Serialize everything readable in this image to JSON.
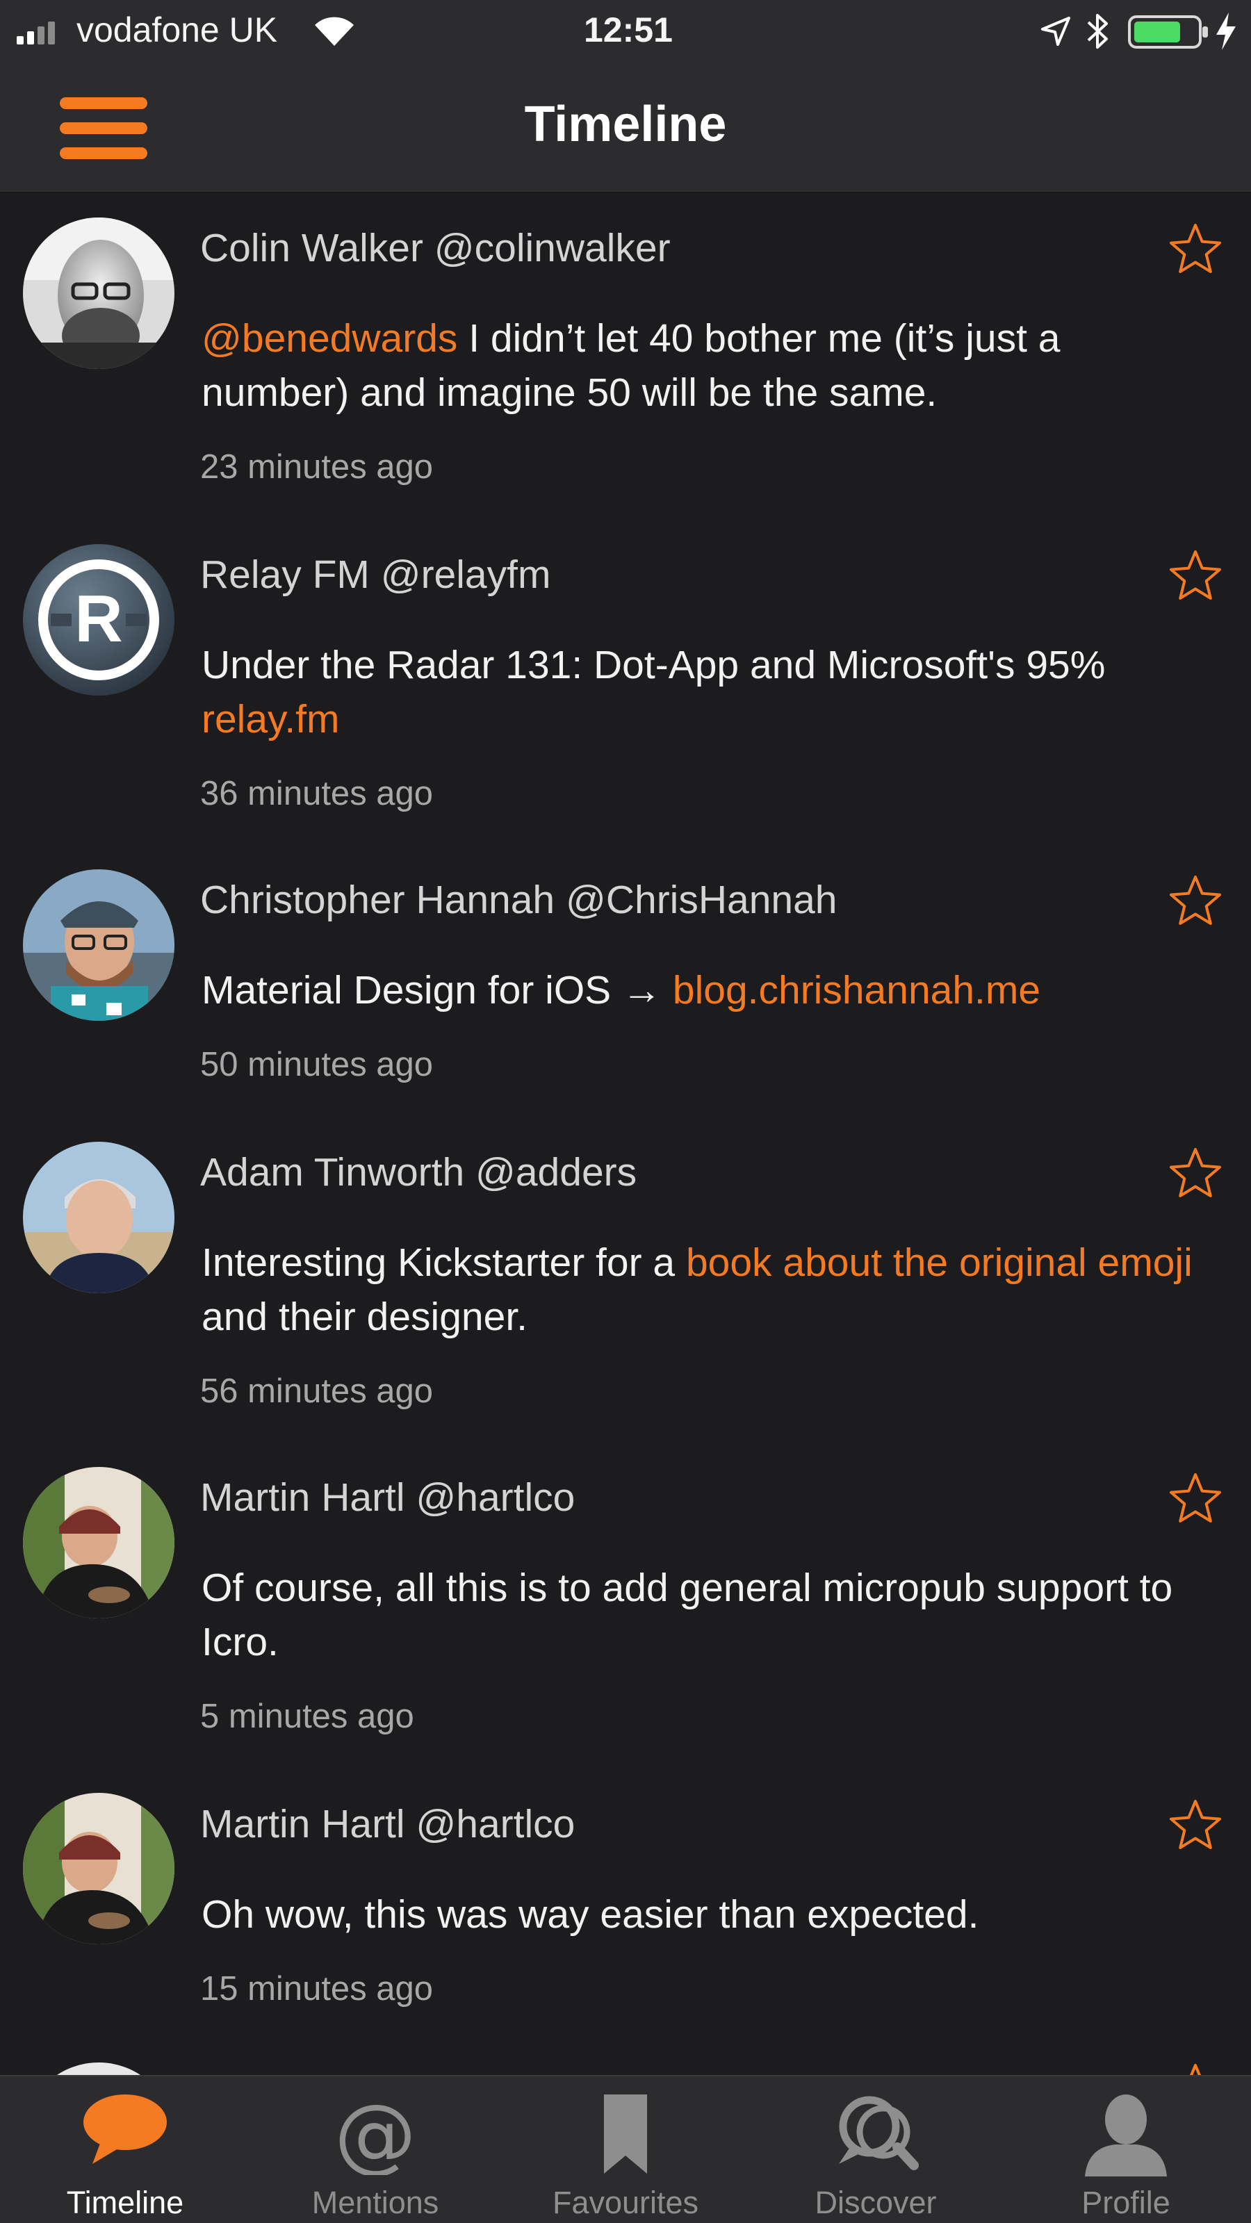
{
  "status_bar": {
    "carrier": "vodafone UK",
    "time": "12:51"
  },
  "nav": {
    "title": "Timeline"
  },
  "posts": [
    {
      "author": "Colin Walker @colinwalker",
      "body": [
        {
          "text": "@benedwards",
          "link": true
        },
        {
          "text": " I didn’t let 40 bother me (it’s just a number) and imagine 50 will be the same.",
          "link": false
        }
      ],
      "time": "23 minutes ago"
    },
    {
      "author": "Relay FM @relayfm",
      "body": [
        {
          "text": "Under the Radar 131: Dot-App and Microsoft's 95% ",
          "link": false
        },
        {
          "text": "relay.fm",
          "link": true
        }
      ],
      "time": "36 minutes ago"
    },
    {
      "author": "Christopher Hannah @ChrisHannah",
      "body": [
        {
          "text": "Material Design for iOS → ",
          "link": false
        },
        {
          "text": "blog.chrishannah.me",
          "link": true
        }
      ],
      "time": "50 minutes ago"
    },
    {
      "author": "Adam Tinworth @adders",
      "body": [
        {
          "text": "Interesting Kickstarter for a ",
          "link": false
        },
        {
          "text": "book about the original emoji",
          "link": true
        },
        {
          "text": " and their designer.",
          "link": false
        }
      ],
      "time": "56 minutes ago"
    },
    {
      "author": "Martin Hartl @hartlco",
      "body": [
        {
          "text": "Of course, all this is to add general micropub support to Icro.",
          "link": false
        }
      ],
      "time": "5 minutes ago"
    },
    {
      "author": "Martin Hartl @hartlco",
      "body": [
        {
          "text": "Oh wow, this was way easier than expected.",
          "link": false
        }
      ],
      "time": "15 minutes ago"
    }
  ],
  "tabs": [
    {
      "label": "Timeline",
      "icon": "speech-bubble-icon",
      "active": true
    },
    {
      "label": "Mentions",
      "icon": "at-sign-icon",
      "active": false
    },
    {
      "label": "Favourites",
      "icon": "bookmark-icon",
      "active": false
    },
    {
      "label": "Discover",
      "icon": "discover-icon",
      "active": false
    },
    {
      "label": "Profile",
      "icon": "person-icon",
      "active": false
    }
  ],
  "colors": {
    "accent": "#f57b22",
    "background": "#1c1c1e",
    "bars": "#2c2c2e",
    "battery": "#4cd964"
  }
}
